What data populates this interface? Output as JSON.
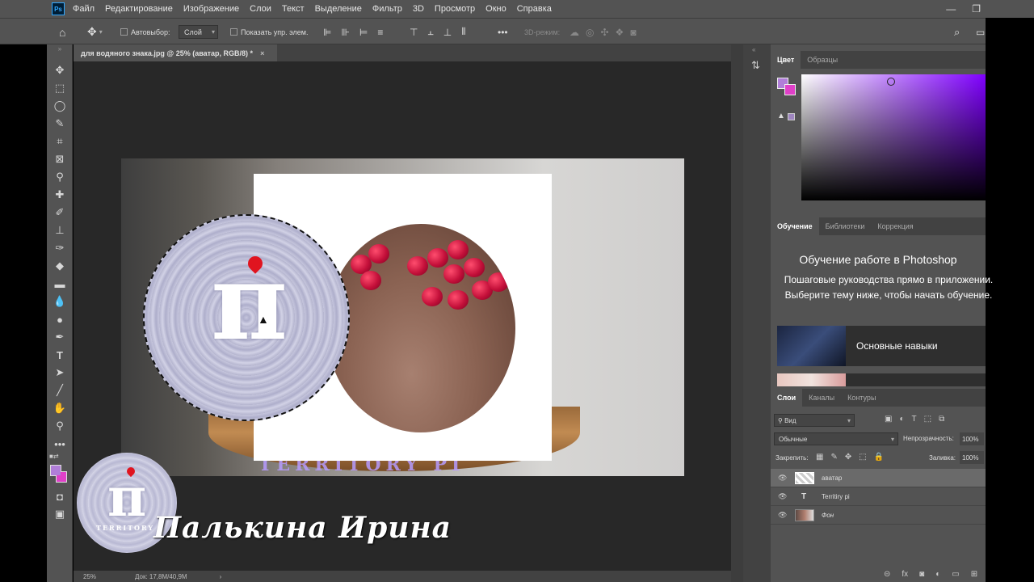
{
  "app": {
    "logo": "Ps"
  },
  "menu": [
    "Файл",
    "Редактирование",
    "Изображение",
    "Слои",
    "Текст",
    "Выделение",
    "Фильтр",
    "3D",
    "Просмотр",
    "Окно",
    "Справка"
  ],
  "window_controls": {
    "minimize": "—",
    "restore": "❐"
  },
  "options": {
    "autoselect_label": "Автовыбор:",
    "autoselect_value": "Слой",
    "show_transform_label": "Показать упр. элем.",
    "mode_3d_label": "3D-режим:"
  },
  "document": {
    "tab_title": "для водяного знака.jpg @ 25% (аватар, RGB/8) *",
    "tab_close": "×",
    "zoom": "25%",
    "doc_size": "Док: 17,8M/40,9M"
  },
  "watermark": {
    "name_text": "Палькина Ирина",
    "brand_text": "TERRITORY",
    "symbol": "π"
  },
  "canvas_text": {
    "territory_overlay": "TERRITORY PI"
  },
  "color_panel": {
    "tabs": [
      "Цвет",
      "Образцы"
    ],
    "active_tab": "Цвет",
    "fg_color": "#b07ed8",
    "bg_color": "#e040c8"
  },
  "learn_panel": {
    "tabs": [
      "Обучение",
      "Библиотеки",
      "Коррекция"
    ],
    "active_tab": "Обучение",
    "title": "Обучение работе в Photoshop",
    "description": "Пошаговые руководства прямо в приложении. Выберите тему ниже, чтобы начать обучение.",
    "card_title": "Основные навыки"
  },
  "layers_panel": {
    "tabs": [
      "Слои",
      "Каналы",
      "Контуры"
    ],
    "active_tab": "Слои",
    "filter_label": "Вид",
    "blend_mode": "Обычные",
    "opacity_label": "Непрозрачность:",
    "opacity_value": "100%",
    "lock_label": "Закрепить:",
    "fill_label": "Заливка:",
    "fill_value": "100%",
    "layers": [
      {
        "name": "аватар",
        "type": "image",
        "active": true
      },
      {
        "name": "Territiry pi",
        "type": "text",
        "active": false
      },
      {
        "name": "Фон",
        "type": "image",
        "active": false
      }
    ]
  }
}
